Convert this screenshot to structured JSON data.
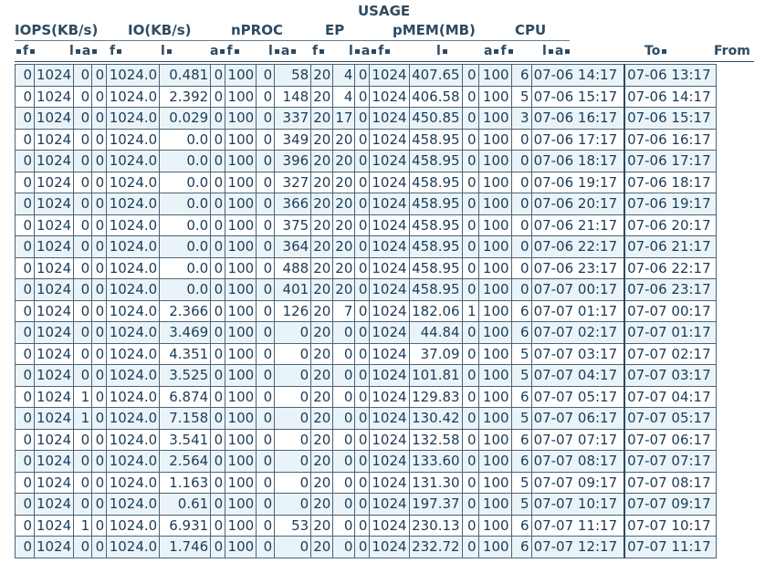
{
  "title": "USAGE",
  "groups": [
    "IOPS(KB/s)",
    "IO(KB/s)",
    "nPROC",
    "EP",
    "pMEM(MB)",
    "CPU"
  ],
  "subheaders": {
    "f": "f",
    "l": "l",
    "a": "a",
    "to": "To",
    "from": "From"
  },
  "rows": [
    [
      "0",
      "1024",
      "0",
      "0",
      "1024.0",
      "0.481",
      "0",
      "100",
      "0",
      "58",
      "20",
      "4",
      "0",
      "1024",
      "407.65",
      "0",
      "100",
      "6",
      "07-06 14:17",
      "07-06 13:17"
    ],
    [
      "0",
      "1024",
      "0",
      "0",
      "1024.0",
      "2.392",
      "0",
      "100",
      "0",
      "148",
      "20",
      "4",
      "0",
      "1024",
      "406.58",
      "0",
      "100",
      "5",
      "07-06 15:17",
      "07-06 14:17"
    ],
    [
      "0",
      "1024",
      "0",
      "0",
      "1024.0",
      "0.029",
      "0",
      "100",
      "0",
      "337",
      "20",
      "17",
      "0",
      "1024",
      "450.85",
      "0",
      "100",
      "3",
      "07-06 16:17",
      "07-06 15:17"
    ],
    [
      "0",
      "1024",
      "0",
      "0",
      "1024.0",
      "0.0",
      "0",
      "100",
      "0",
      "349",
      "20",
      "20",
      "0",
      "1024",
      "458.95",
      "0",
      "100",
      "0",
      "07-06 17:17",
      "07-06 16:17"
    ],
    [
      "0",
      "1024",
      "0",
      "0",
      "1024.0",
      "0.0",
      "0",
      "100",
      "0",
      "396",
      "20",
      "20",
      "0",
      "1024",
      "458.95",
      "0",
      "100",
      "0",
      "07-06 18:17",
      "07-06 17:17"
    ],
    [
      "0",
      "1024",
      "0",
      "0",
      "1024.0",
      "0.0",
      "0",
      "100",
      "0",
      "327",
      "20",
      "20",
      "0",
      "1024",
      "458.95",
      "0",
      "100",
      "0",
      "07-06 19:17",
      "07-06 18:17"
    ],
    [
      "0",
      "1024",
      "0",
      "0",
      "1024.0",
      "0.0",
      "0",
      "100",
      "0",
      "366",
      "20",
      "20",
      "0",
      "1024",
      "458.95",
      "0",
      "100",
      "0",
      "07-06 20:17",
      "07-06 19:17"
    ],
    [
      "0",
      "1024",
      "0",
      "0",
      "1024.0",
      "0.0",
      "0",
      "100",
      "0",
      "375",
      "20",
      "20",
      "0",
      "1024",
      "458.95",
      "0",
      "100",
      "0",
      "07-06 21:17",
      "07-06 20:17"
    ],
    [
      "0",
      "1024",
      "0",
      "0",
      "1024.0",
      "0.0",
      "0",
      "100",
      "0",
      "364",
      "20",
      "20",
      "0",
      "1024",
      "458.95",
      "0",
      "100",
      "0",
      "07-06 22:17",
      "07-06 21:17"
    ],
    [
      "0",
      "1024",
      "0",
      "0",
      "1024.0",
      "0.0",
      "0",
      "100",
      "0",
      "488",
      "20",
      "20",
      "0",
      "1024",
      "458.95",
      "0",
      "100",
      "0",
      "07-06 23:17",
      "07-06 22:17"
    ],
    [
      "0",
      "1024",
      "0",
      "0",
      "1024.0",
      "0.0",
      "0",
      "100",
      "0",
      "401",
      "20",
      "20",
      "0",
      "1024",
      "458.95",
      "0",
      "100",
      "0",
      "07-07 00:17",
      "07-06 23:17"
    ],
    [
      "0",
      "1024",
      "0",
      "0",
      "1024.0",
      "2.366",
      "0",
      "100",
      "0",
      "126",
      "20",
      "7",
      "0",
      "1024",
      "182.06",
      "1",
      "100",
      "6",
      "07-07 01:17",
      "07-07 00:17"
    ],
    [
      "0",
      "1024",
      "0",
      "0",
      "1024.0",
      "3.469",
      "0",
      "100",
      "0",
      "0",
      "20",
      "0",
      "0",
      "1024",
      "44.84",
      "0",
      "100",
      "6",
      "07-07 02:17",
      "07-07 01:17"
    ],
    [
      "0",
      "1024",
      "0",
      "0",
      "1024.0",
      "4.351",
      "0",
      "100",
      "0",
      "0",
      "20",
      "0",
      "0",
      "1024",
      "37.09",
      "0",
      "100",
      "5",
      "07-07 03:17",
      "07-07 02:17"
    ],
    [
      "0",
      "1024",
      "0",
      "0",
      "1024.0",
      "3.525",
      "0",
      "100",
      "0",
      "0",
      "20",
      "0",
      "0",
      "1024",
      "101.81",
      "0",
      "100",
      "5",
      "07-07 04:17",
      "07-07 03:17"
    ],
    [
      "0",
      "1024",
      "1",
      "0",
      "1024.0",
      "6.874",
      "0",
      "100",
      "0",
      "0",
      "20",
      "0",
      "0",
      "1024",
      "129.83",
      "0",
      "100",
      "6",
      "07-07 05:17",
      "07-07 04:17"
    ],
    [
      "0",
      "1024",
      "1",
      "0",
      "1024.0",
      "7.158",
      "0",
      "100",
      "0",
      "0",
      "20",
      "0",
      "0",
      "1024",
      "130.42",
      "0",
      "100",
      "5",
      "07-07 06:17",
      "07-07 05:17"
    ],
    [
      "0",
      "1024",
      "0",
      "0",
      "1024.0",
      "3.541",
      "0",
      "100",
      "0",
      "0",
      "20",
      "0",
      "0",
      "1024",
      "132.58",
      "0",
      "100",
      "6",
      "07-07 07:17",
      "07-07 06:17"
    ],
    [
      "0",
      "1024",
      "0",
      "0",
      "1024.0",
      "2.564",
      "0",
      "100",
      "0",
      "0",
      "20",
      "0",
      "0",
      "1024",
      "133.60",
      "0",
      "100",
      "6",
      "07-07 08:17",
      "07-07 07:17"
    ],
    [
      "0",
      "1024",
      "0",
      "0",
      "1024.0",
      "1.163",
      "0",
      "100",
      "0",
      "0",
      "20",
      "0",
      "0",
      "1024",
      "131.30",
      "0",
      "100",
      "5",
      "07-07 09:17",
      "07-07 08:17"
    ],
    [
      "0",
      "1024",
      "0",
      "0",
      "1024.0",
      "0.61",
      "0",
      "100",
      "0",
      "0",
      "20",
      "0",
      "0",
      "1024",
      "197.37",
      "0",
      "100",
      "5",
      "07-07 10:17",
      "07-07 09:17"
    ],
    [
      "0",
      "1024",
      "1",
      "0",
      "1024.0",
      "6.931",
      "0",
      "100",
      "0",
      "53",
      "20",
      "0",
      "0",
      "1024",
      "230.13",
      "0",
      "100",
      "6",
      "07-07 11:17",
      "07-07 10:17"
    ],
    [
      "0",
      "1024",
      "0",
      "0",
      "1024.0",
      "1.746",
      "0",
      "100",
      "0",
      "0",
      "20",
      "0",
      "0",
      "1024",
      "232.72",
      "0",
      "100",
      "6",
      "07-07 12:17",
      "07-07 11:17"
    ]
  ]
}
